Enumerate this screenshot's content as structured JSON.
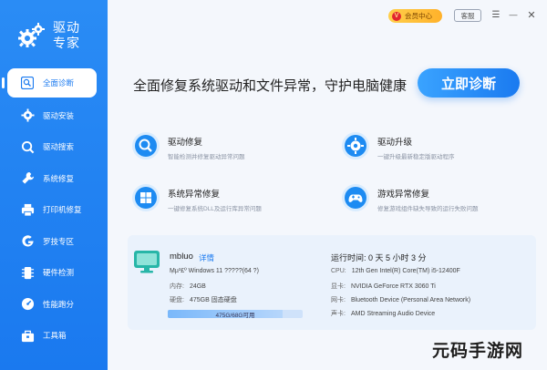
{
  "brand": {
    "line1": "驱动",
    "line2": "专家"
  },
  "sidebar": {
    "items": [
      {
        "label": "全面诊断",
        "icon": "search-icon",
        "active": true
      },
      {
        "label": "驱动安装",
        "icon": "gear-icon"
      },
      {
        "label": "驱动搜索",
        "icon": "magnifier-icon"
      },
      {
        "label": "系统修复",
        "icon": "wrench-icon"
      },
      {
        "label": "打印机修复",
        "icon": "printer-icon"
      },
      {
        "label": "罗技专区",
        "icon": "logitech-icon"
      },
      {
        "label": "硬件检测",
        "icon": "chip-icon"
      },
      {
        "label": "性能跑分",
        "icon": "speedometer-icon"
      },
      {
        "label": "工具箱",
        "icon": "toolbox-icon"
      }
    ]
  },
  "topbar": {
    "vip_label": "会员中心",
    "vip_badge": "V",
    "service_label": "客服",
    "menu_glyph": "☰",
    "minimize_glyph": "—",
    "close_glyph": "✕"
  },
  "hero": {
    "text": "全面修复系统驱动和文件异常，守护电脑健康",
    "button_label": "立即诊断"
  },
  "features": [
    {
      "title": "驱动修复",
      "desc": "智能检测并修复驱动异常问题",
      "icon": "driver-repair-icon"
    },
    {
      "title": "驱动升级",
      "desc": "一键升级最新稳定版驱动程序",
      "icon": "driver-upgrade-icon"
    },
    {
      "title": "系统异常修复",
      "desc": "一键修复系统DLL及运行库异常问题",
      "icon": "windows-icon"
    },
    {
      "title": "游戏异常修复",
      "desc": "修复游戏组件缺失导致的运行失败问题",
      "icon": "gamepad-icon"
    }
  ],
  "info": {
    "pc_name": "mbluo",
    "detail_link": "详情",
    "os_value": "Ṃµ³£º Windows 11 ?????(64 ?)",
    "ram_key": "内存:",
    "ram_value": "24GB",
    "disk_key": "硬盘:",
    "disk_value": "475GB 固态硬盘",
    "disk_usage_text": "475G/68G可用",
    "disk_fill_fraction": 0.85,
    "runtime": "运行时间: 0 天 5 小时 3 分",
    "specs": [
      {
        "key": "CPU:",
        "value": "12th Gen Intel(R) Core(TM) i5-12400F"
      },
      {
        "key": "显卡:",
        "value": "NVIDIA GeForce RTX 3060 Ti"
      },
      {
        "key": "网卡:",
        "value": "Bluetooth Device (Personal Area Network)"
      },
      {
        "key": "声卡:",
        "value": "AMD Streaming Audio Device"
      }
    ]
  },
  "watermark": "元码手游网",
  "colors": {
    "accent": "#1a7af0",
    "sidebar": "#2a8cf5",
    "vip": "#ffbd35"
  }
}
